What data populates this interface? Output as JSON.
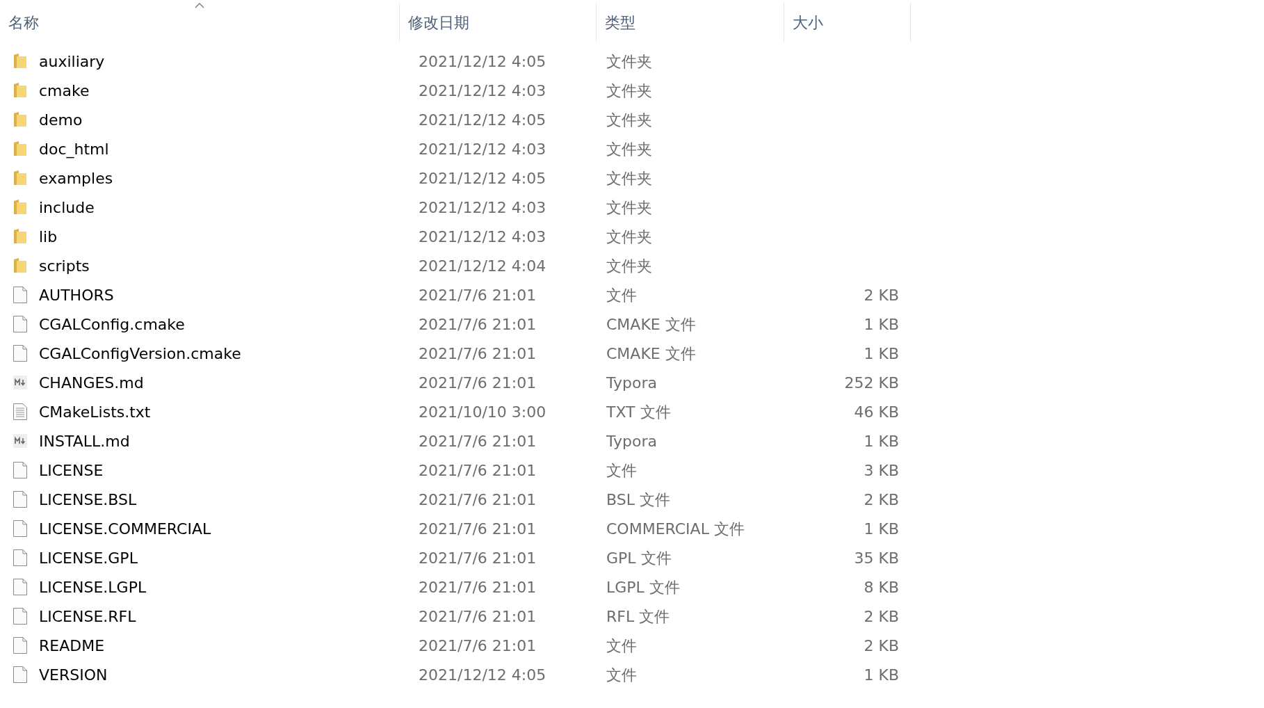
{
  "columns": [
    {
      "label": "名称",
      "sorted": true
    },
    {
      "label": "修改日期",
      "sorted": false
    },
    {
      "label": "类型",
      "sorted": false
    },
    {
      "label": "大小",
      "sorted": false
    }
  ],
  "rows": [
    {
      "kind": "folder",
      "name": "auxiliary",
      "date": "2021/12/12 4:05",
      "type": "文件夹"
    },
    {
      "kind": "folder",
      "name": "cmake",
      "date": "2021/12/12 4:03",
      "type": "文件夹"
    },
    {
      "kind": "folder",
      "name": "demo",
      "date": "2021/12/12 4:05",
      "type": "文件夹"
    },
    {
      "kind": "folder",
      "name": "doc_html",
      "date": "2021/12/12 4:03",
      "type": "文件夹"
    },
    {
      "kind": "folder",
      "name": "examples",
      "date": "2021/12/12 4:05",
      "type": "文件夹"
    },
    {
      "kind": "folder",
      "name": "include",
      "date": "2021/12/12 4:03",
      "type": "文件夹"
    },
    {
      "kind": "folder",
      "name": "lib",
      "date": "2021/12/12 4:03",
      "type": "文件夹"
    },
    {
      "kind": "folder",
      "name": "scripts",
      "date": "2021/12/12 4:04",
      "type": "文件夹"
    },
    {
      "kind": "file",
      "name": "AUTHORS",
      "date": "2021/7/6 21:01",
      "type": "文件",
      "size": "2 KB"
    },
    {
      "kind": "file",
      "name": "CGALConfig.cmake",
      "date": "2021/7/6 21:01",
      "type": "CMAKE 文件",
      "size": "1 KB"
    },
    {
      "kind": "file",
      "name": "CGALConfigVersion.cmake",
      "date": "2021/7/6 21:01",
      "type": "CMAKE 文件",
      "size": "1 KB"
    },
    {
      "kind": "markdown",
      "name": "CHANGES.md",
      "date": "2021/7/6 21:01",
      "type": "Typora",
      "size": "252 KB"
    },
    {
      "kind": "text",
      "name": "CMakeLists.txt",
      "date": "2021/10/10 3:00",
      "type": "TXT 文件",
      "size": "46 KB"
    },
    {
      "kind": "markdown",
      "name": "INSTALL.md",
      "date": "2021/7/6 21:01",
      "type": "Typora",
      "size": "1 KB"
    },
    {
      "kind": "file",
      "name": "LICENSE",
      "date": "2021/7/6 21:01",
      "type": "文件",
      "size": "3 KB"
    },
    {
      "kind": "file",
      "name": "LICENSE.BSL",
      "date": "2021/7/6 21:01",
      "type": "BSL 文件",
      "size": "2 KB"
    },
    {
      "kind": "file",
      "name": "LICENSE.COMMERCIAL",
      "date": "2021/7/6 21:01",
      "type": "COMMERCIAL 文件",
      "size": "1 KB"
    },
    {
      "kind": "file",
      "name": "LICENSE.GPL",
      "date": "2021/7/6 21:01",
      "type": "GPL 文件",
      "size": "35 KB"
    },
    {
      "kind": "file",
      "name": "LICENSE.LGPL",
      "date": "2021/7/6 21:01",
      "type": "LGPL 文件",
      "size": "8 KB"
    },
    {
      "kind": "file",
      "name": "LICENSE.RFL",
      "date": "2021/7/6 21:01",
      "type": "RFL 文件",
      "size": "2 KB"
    },
    {
      "kind": "file",
      "name": "README",
      "date": "2021/7/6 21:01",
      "type": "文件",
      "size": "2 KB"
    },
    {
      "kind": "file",
      "name": "VERSION",
      "date": "2021/12/12 4:05",
      "type": "文件",
      "size": "1 KB"
    }
  ]
}
